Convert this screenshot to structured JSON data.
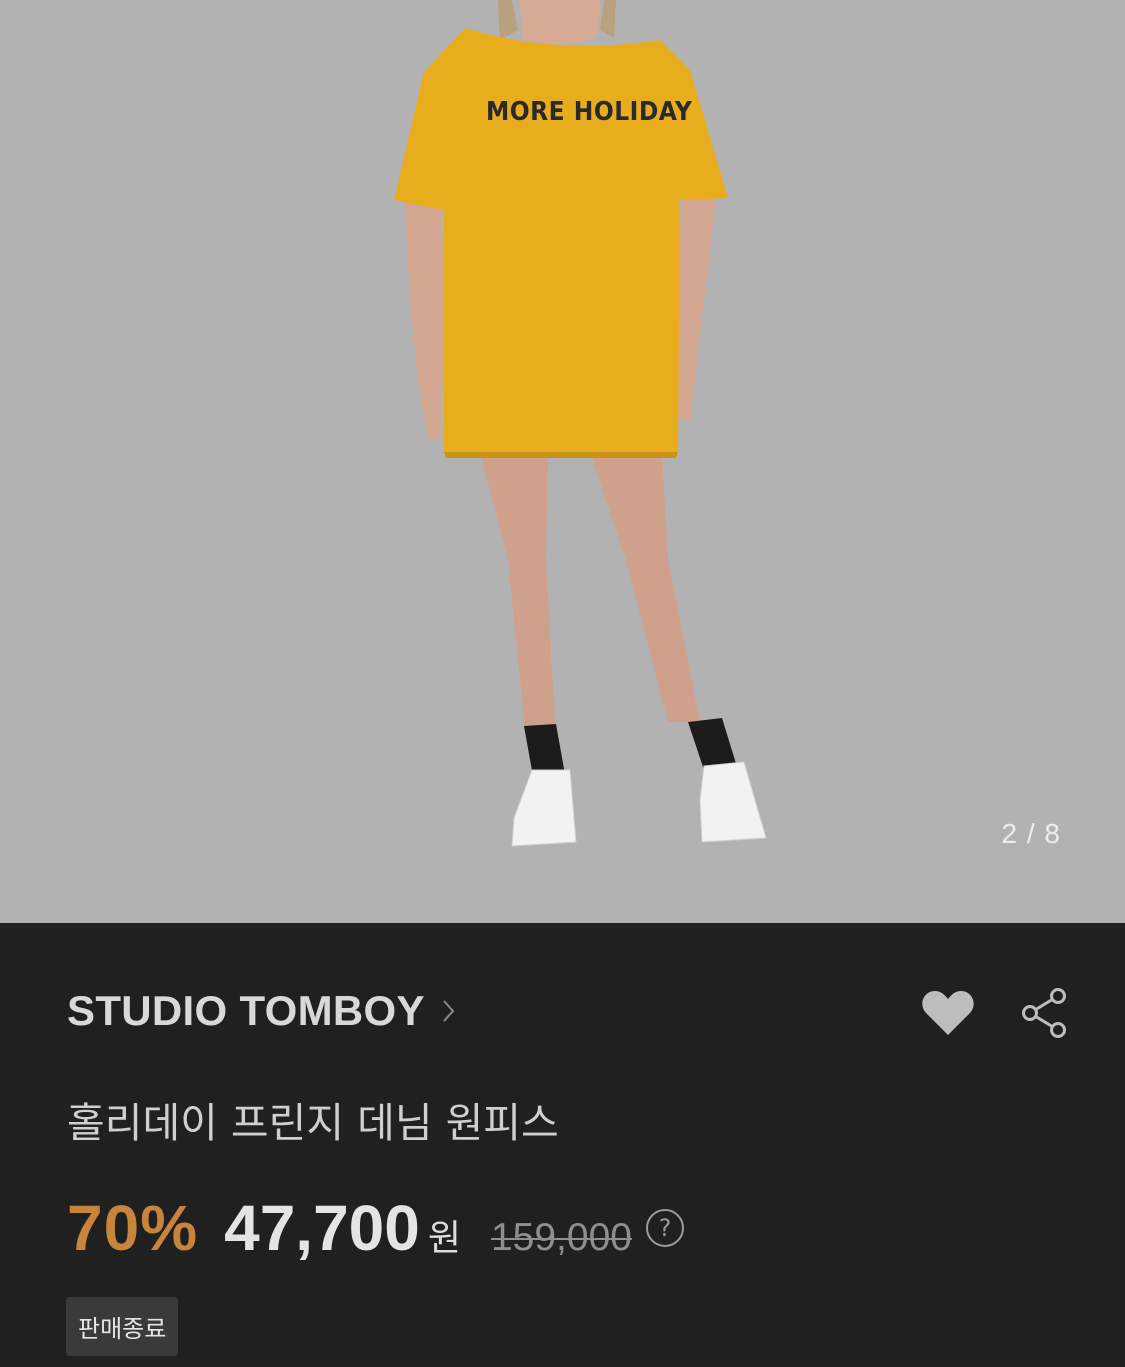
{
  "gallery": {
    "shirt_print": "MORE HOLIDAY",
    "counter": "2 / 8",
    "background_color": "#b2b2b2"
  },
  "product": {
    "brand": "STUDIO TOMBOY",
    "title": "홀리데이 프린지 데님 원피스",
    "discount": "70%",
    "price": "47,700",
    "currency": "원",
    "original_price": "159,000",
    "help": "?",
    "status": "판매종료"
  },
  "icons": {
    "brand_chevron": "chevron-right-icon",
    "wishlist": "heart-icon",
    "share": "share-icon"
  },
  "colors": {
    "discount": "#c9843c",
    "panel_background": "#202020"
  }
}
